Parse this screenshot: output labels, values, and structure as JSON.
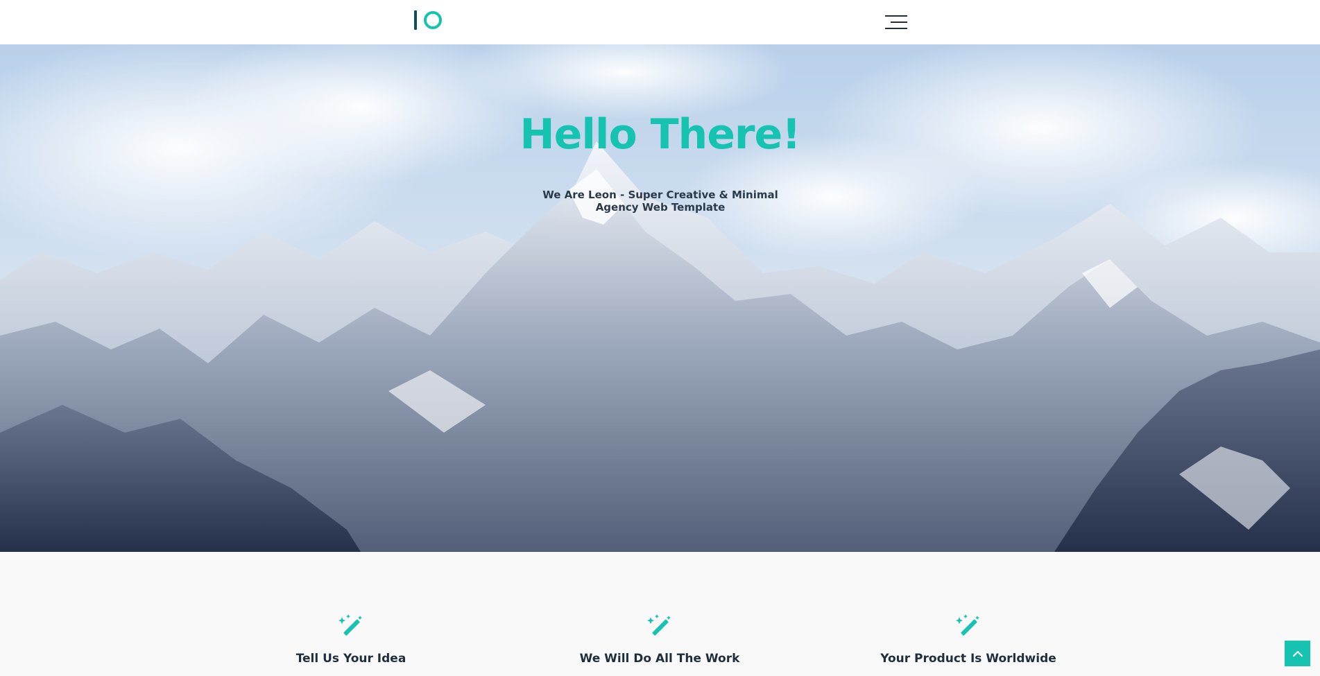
{
  "brand": {
    "accent": "#16c3b0",
    "dark": "#1f2e3d"
  },
  "header": {
    "logo_icon": "io-logo",
    "menu_icon": "hamburger-menu-icon"
  },
  "hero": {
    "title": "Hello There!",
    "subtitle": "We Are Leon - Super Creative & Minimal Agency Web Template",
    "background": "snowy-mountain-range-photo"
  },
  "features": [
    {
      "icon": "magic-wand-icon",
      "title": "Tell Us Your Idea"
    },
    {
      "icon": "magic-wand-icon",
      "title": "We Will Do All The Work"
    },
    {
      "icon": "magic-wand-icon",
      "title": "Your Product Is Worldwide"
    }
  ],
  "scroll_top": {
    "icon": "chevron-up-icon"
  }
}
